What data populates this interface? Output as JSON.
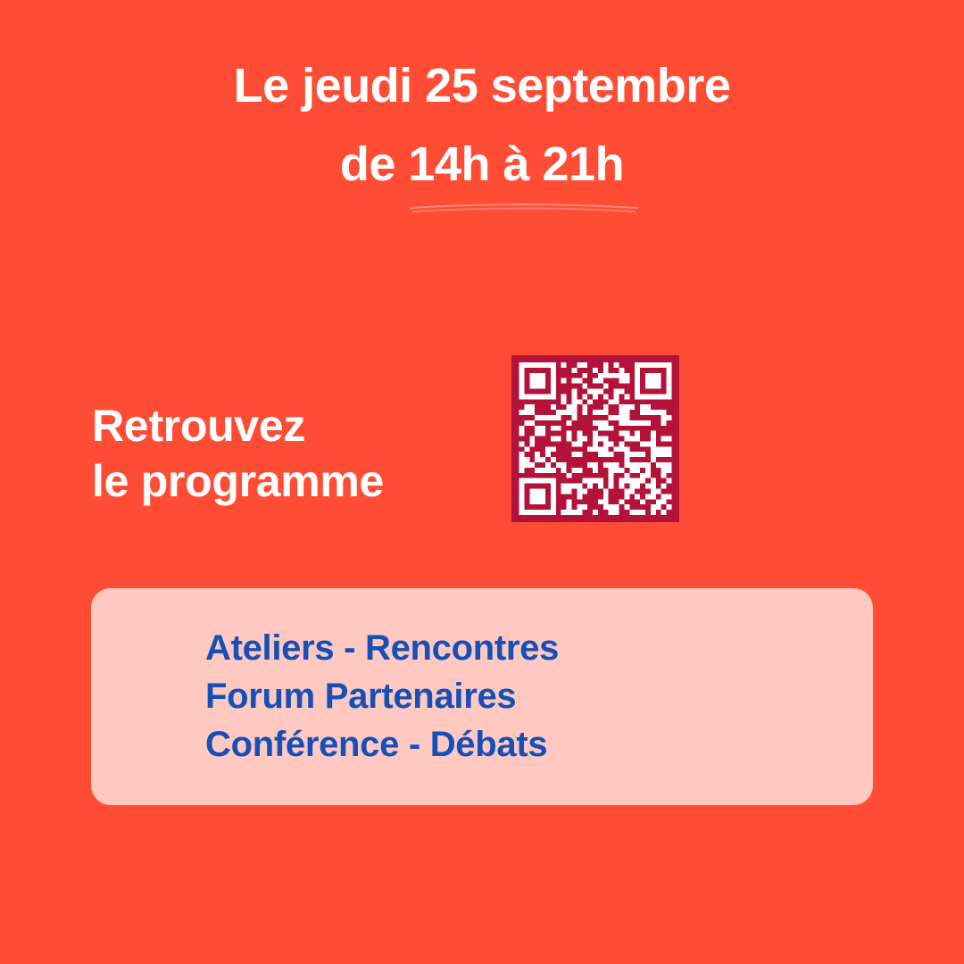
{
  "header": {
    "date_line": "Le jeudi 25 septembre",
    "time_line": "de 14h à 21h"
  },
  "cta": {
    "line1": "Retrouvez",
    "line2": "le programme"
  },
  "qr": {
    "icon": "qr-code-icon",
    "color_fg": "#ffffff",
    "color_bg": "#B3123A"
  },
  "topics": {
    "items": [
      "Ateliers - Rencontres",
      "Forum Partenaires",
      "Conférence - Débats"
    ]
  },
  "colors": {
    "background": "#FF4D35",
    "card": "#FFC8C0",
    "topics_text": "#1450B8",
    "headline_text": "#ffffff"
  }
}
